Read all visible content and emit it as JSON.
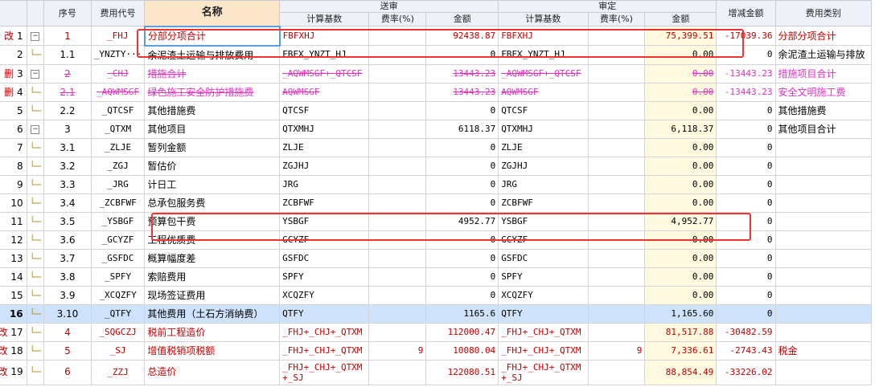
{
  "headers": {
    "seq": "序号",
    "code": "费用代号",
    "name": "名称",
    "submitted": "送审",
    "approved": "审定",
    "base": "计算基数",
    "rate": "费率(%)",
    "amount": "金额",
    "diff": "增减金额",
    "category": "费用类别"
  },
  "rows": [
    {
      "num": "1",
      "mark": "改",
      "exp": "−",
      "seq": "1",
      "code": "_FHJ",
      "name": "分部分项合计",
      "s_base": "FBFXHJ",
      "s_rate": "",
      "s_amt": "92438.87",
      "a_base": "FBFXHJ",
      "a_rate": "",
      "a_amt": "75,399.51",
      "diff": "-17039.36",
      "cat": "分部分项合计",
      "style": "red"
    },
    {
      "num": "2",
      "mark": "",
      "exp": "",
      "seq": "1.1",
      "code": "_YNZTY···",
      "name": "余泥渣土运输与排放费用",
      "s_base": "FBFX_YNZT_HJ",
      "s_rate": "",
      "s_amt": "0",
      "a_base": "FBFX_YNZT_HJ",
      "a_rate": "",
      "a_amt": "0.00",
      "diff": "0",
      "cat": "余泥渣土运输与排放",
      "style": ""
    },
    {
      "num": "3",
      "mark": "删",
      "exp": "−",
      "seq": "2",
      "code": "_CHJ",
      "name": "措施合计",
      "s_base": "_AQWMSGF+_QTCSF",
      "s_rate": "",
      "s_amt": "13443.23",
      "a_base": "_AQWMSGF+_QTCSF",
      "a_rate": "",
      "a_amt": "0.00",
      "diff": "-13443.23",
      "cat": "措施项目合计",
      "style": "mag"
    },
    {
      "num": "4",
      "mark": "删",
      "exp": "",
      "seq": "2.1",
      "code": "_AQWMSGF",
      "name": "绿色施工安全防护措施费",
      "s_base": "AQWMSGF",
      "s_rate": "",
      "s_amt": "13443.23",
      "a_base": "AQWMSGF",
      "a_rate": "",
      "a_amt": "0.00",
      "diff": "-13443.23",
      "cat": "安全文明施工费",
      "style": "mag"
    },
    {
      "num": "5",
      "mark": "",
      "exp": "",
      "seq": "2.2",
      "code": "_QTCSF",
      "name": "其他措施费",
      "s_base": "QTCSF",
      "s_rate": "",
      "s_amt": "0",
      "a_base": "QTCSF",
      "a_rate": "",
      "a_amt": "0.00",
      "diff": "0",
      "cat": "其他措施费",
      "style": ""
    },
    {
      "num": "6",
      "mark": "",
      "exp": "−",
      "seq": "3",
      "code": "_QTXM",
      "name": "其他项目",
      "s_base": "QTXMHJ",
      "s_rate": "",
      "s_amt": "6118.37",
      "a_base": "QTXMHJ",
      "a_rate": "",
      "a_amt": "6,118.37",
      "diff": "0",
      "cat": "其他项目合计",
      "style": ""
    },
    {
      "num": "7",
      "mark": "",
      "exp": "",
      "seq": "3.1",
      "code": "_ZLJE",
      "name": "暂列金额",
      "s_base": "ZLJE",
      "s_rate": "",
      "s_amt": "0",
      "a_base": "ZLJE",
      "a_rate": "",
      "a_amt": "0.00",
      "diff": "0",
      "cat": "",
      "style": ""
    },
    {
      "num": "8",
      "mark": "",
      "exp": "",
      "seq": "3.2",
      "code": "_ZGJ",
      "name": "暂估价",
      "s_base": "ZGJHJ",
      "s_rate": "",
      "s_amt": "0",
      "a_base": "ZGJHJ",
      "a_rate": "",
      "a_amt": "0.00",
      "diff": "0",
      "cat": "",
      "style": ""
    },
    {
      "num": "9",
      "mark": "",
      "exp": "",
      "seq": "3.3",
      "code": "_JRG",
      "name": "计日工",
      "s_base": "JRG",
      "s_rate": "",
      "s_amt": "0",
      "a_base": "JRG",
      "a_rate": "",
      "a_amt": "0.00",
      "diff": "0",
      "cat": "",
      "style": ""
    },
    {
      "num": "10",
      "mark": "",
      "exp": "",
      "seq": "3.4",
      "code": "_ZCBFWF",
      "name": "总承包服务费",
      "s_base": "ZCBFWF",
      "s_rate": "",
      "s_amt": "0",
      "a_base": "ZCBFWF",
      "a_rate": "",
      "a_amt": "0.00",
      "diff": "0",
      "cat": "",
      "style": ""
    },
    {
      "num": "11",
      "mark": "",
      "exp": "",
      "seq": "3.5",
      "code": "_YSBGF",
      "name": "预算包干费",
      "s_base": "YSBGF",
      "s_rate": "",
      "s_amt": "4952.77",
      "a_base": "YSBGF",
      "a_rate": "",
      "a_amt": "4,952.77",
      "diff": "0",
      "cat": "",
      "style": ""
    },
    {
      "num": "12",
      "mark": "",
      "exp": "",
      "seq": "3.6",
      "code": "_GCYZF",
      "name": "工程优质费",
      "s_base": "GCYZF",
      "s_rate": "",
      "s_amt": "0",
      "a_base": "GCYZF",
      "a_rate": "",
      "a_amt": "0.00",
      "diff": "0",
      "cat": "",
      "style": ""
    },
    {
      "num": "13",
      "mark": "",
      "exp": "",
      "seq": "3.7",
      "code": "_GSFDC",
      "name": "概算幅度差",
      "s_base": "GSFDC",
      "s_rate": "",
      "s_amt": "0",
      "a_base": "GSFDC",
      "a_rate": "",
      "a_amt": "0.00",
      "diff": "0",
      "cat": "",
      "style": ""
    },
    {
      "num": "14",
      "mark": "",
      "exp": "",
      "seq": "3.8",
      "code": "_SPFY",
      "name": "索赔费用",
      "s_base": "SPFY",
      "s_rate": "",
      "s_amt": "0",
      "a_base": "SPFY",
      "a_rate": "",
      "a_amt": "0.00",
      "diff": "0",
      "cat": "",
      "style": ""
    },
    {
      "num": "15",
      "mark": "",
      "exp": "",
      "seq": "3.9",
      "code": "_XCQZFY",
      "name": "现场签证费用",
      "s_base": "XCQZFY",
      "s_rate": "",
      "s_amt": "0",
      "a_base": "XCQZFY",
      "a_rate": "",
      "a_amt": "0.00",
      "diff": "0",
      "cat": "",
      "style": ""
    },
    {
      "num": "16",
      "mark": "",
      "exp": "",
      "seq": "3.10",
      "code": "_QTFY",
      "name": "其他费用（土石方消纳费）",
      "s_base": "QTFY",
      "s_rate": "",
      "s_amt": "1165.6",
      "a_base": "QTFY",
      "a_rate": "",
      "a_amt": "1,165.60",
      "diff": "0",
      "cat": "",
      "style": "sel"
    },
    {
      "num": "17",
      "mark": "改",
      "exp": "",
      "seq": "4",
      "code": "_SQGCZJ",
      "name": "税前工程造价",
      "s_base": "_FHJ+_CHJ+_QTXM",
      "s_rate": "",
      "s_amt": "112000.47",
      "a_base": "_FHJ+_CHJ+_QTXM",
      "a_rate": "",
      "a_amt": "81,517.88",
      "diff": "-30482.59",
      "cat": "",
      "style": "red"
    },
    {
      "num": "18",
      "mark": "改",
      "exp": "",
      "seq": "5",
      "code": "_SJ",
      "name": "增值税销项税额",
      "s_base": "_FHJ+_CHJ+_QTXM",
      "s_rate": "9",
      "s_amt": "10080.04",
      "a_base": "_FHJ+_CHJ+_QTXM",
      "a_rate": "9",
      "a_amt": "7,336.61",
      "diff": "-2743.43",
      "cat": "税金",
      "style": "red"
    },
    {
      "num": "19",
      "mark": "改",
      "exp": "",
      "seq": "6",
      "code": "_ZZJ",
      "name": "总造价",
      "s_base": "_FHJ+_CHJ+_QTXM",
      "s_base2": "+_SJ",
      "s_rate": "",
      "s_amt": "122080.51",
      "a_base": "_FHJ+_CHJ+_QTXM",
      "a_base2": "+_SJ",
      "a_rate": "",
      "a_amt": "88,854.49",
      "diff": "-33226.02",
      "cat": "",
      "style": "red"
    }
  ]
}
